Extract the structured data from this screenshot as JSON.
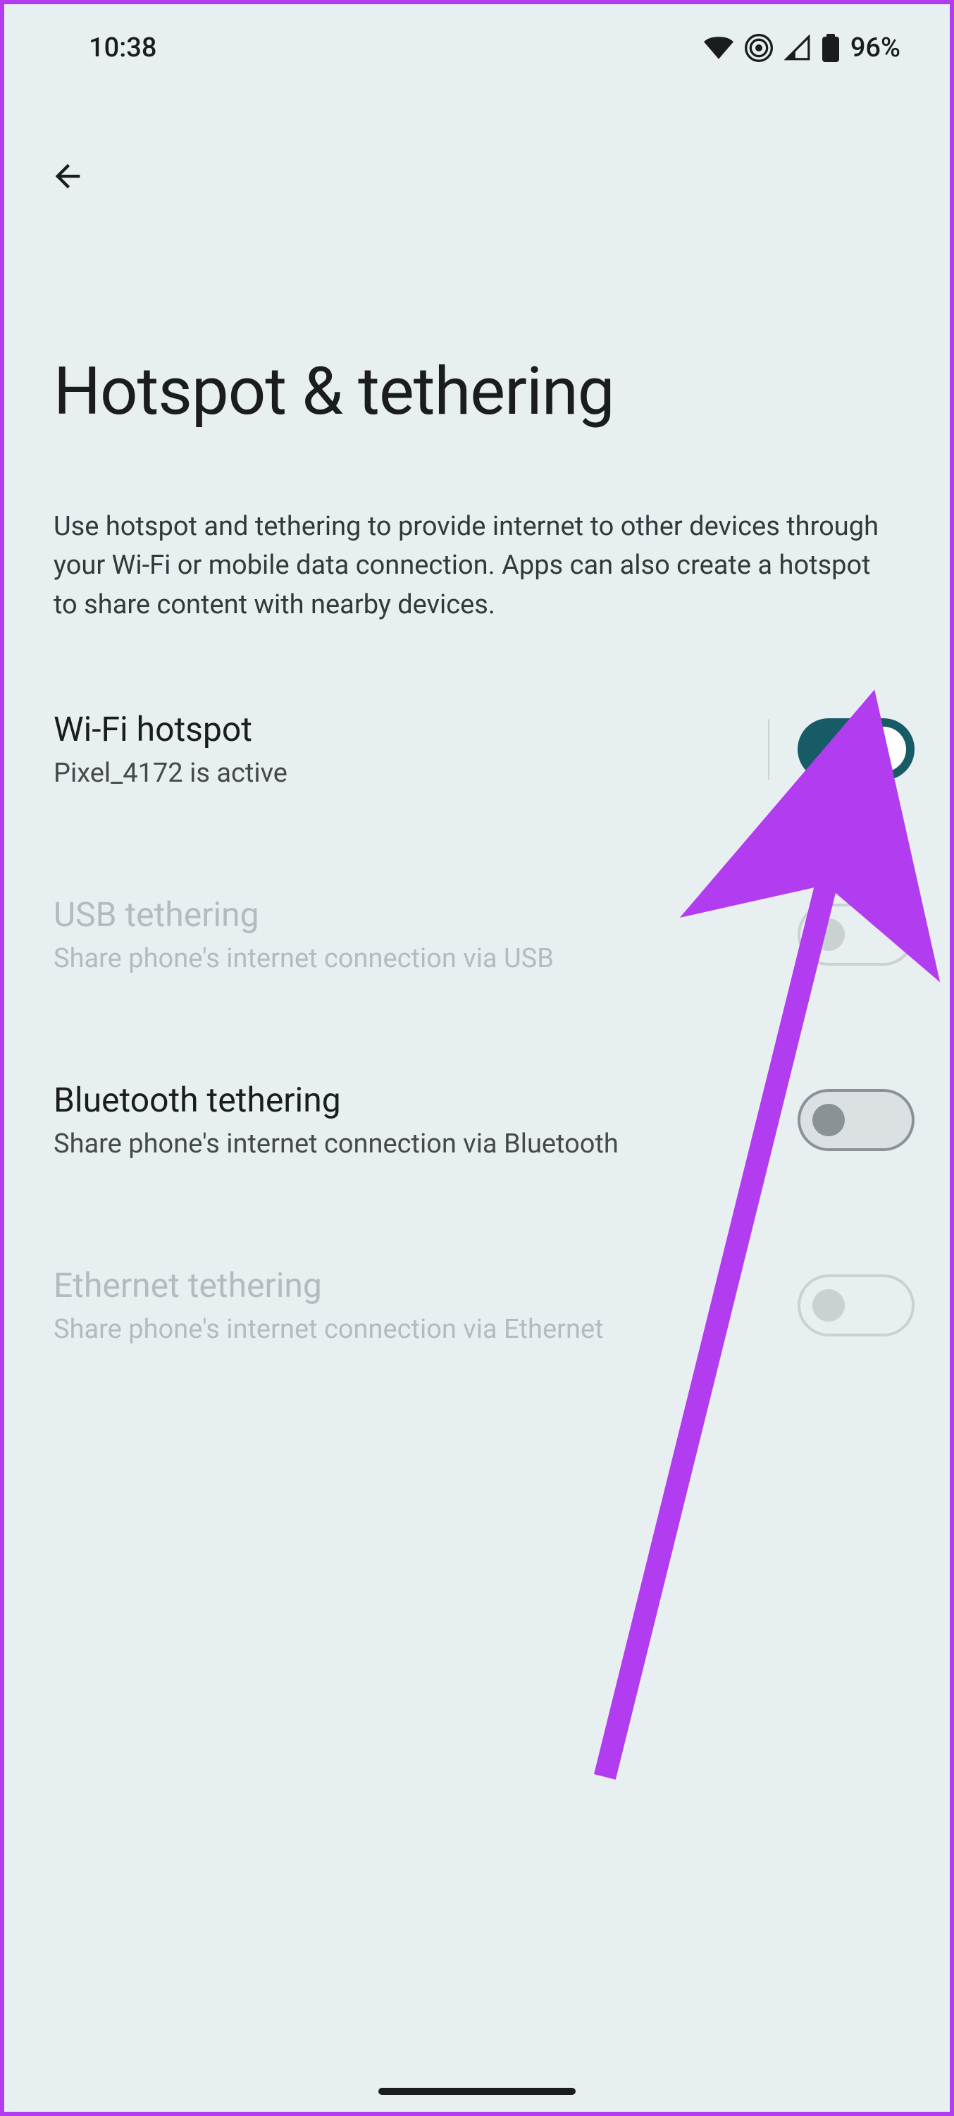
{
  "status_bar": {
    "time": "10:38",
    "battery_text": "96%"
  },
  "page": {
    "title": "Hotspot & tethering",
    "description": "Use hotspot and tethering to provide internet to other devices through your Wi-Fi or mobile data connection. Apps can also create a hotspot to share content with nearby devices."
  },
  "settings": {
    "wifi_hotspot": {
      "title": "Wi-Fi hotspot",
      "subtitle": "Pixel_4172 is active"
    },
    "usb_tethering": {
      "title": "USB tethering",
      "subtitle": "Share phone's internet connection via USB"
    },
    "bluetooth_tethering": {
      "title": "Bluetooth tethering",
      "subtitle": "Share phone's internet connection via Bluetooth"
    },
    "ethernet_tethering": {
      "title": "Ethernet tethering",
      "subtitle": "Share phone's internet connection via Ethernet"
    }
  }
}
